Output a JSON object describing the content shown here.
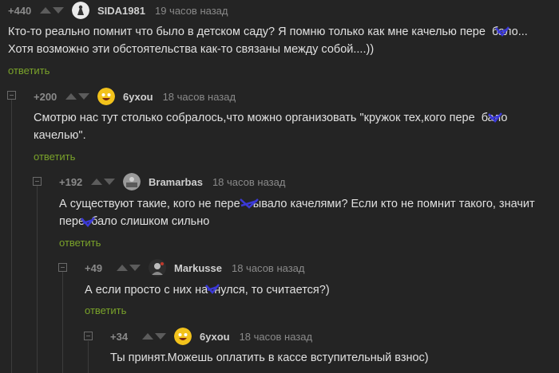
{
  "comments": [
    {
      "rating": "+440",
      "username": "SIDA1981",
      "time": "19 часов назад",
      "avatar_color": "#eaeaea",
      "text_line1": "Кто-то реально помнит что было в детском саду? Я помню только как мне качелью пере  бало...",
      "text_line2": "Хотя возможно эти обстоятельства как-то связаны между собой....))",
      "reply": "ответить"
    },
    {
      "rating": "+200",
      "username": "6yxou",
      "time": "18 часов назад",
      "avatar_color": "#f2c21b",
      "text_line1": "Смотрю нас тут столько собралось,что можно организовать \"кружок тех,кого пере  бало",
      "text_line2": "качелью\".",
      "reply": "ответить"
    },
    {
      "rating": "+192",
      "username": "Bramarbas",
      "time": "18 часов назад",
      "avatar_color": "#9a9a9a",
      "text_line1": "А существуют такие, кого не пере    ывало качелями? Если кто не помнит такого, значит",
      "text_line2": "пере  бало слишком сильно",
      "reply": "ответить"
    },
    {
      "rating": "+49",
      "username": "Markusse",
      "time": "18 часов назад",
      "avatar_color": "#7a7a7a",
      "text_line1": "А если просто с них на  нулся, то считается?)",
      "reply": "ответить"
    },
    {
      "rating": "+34",
      "username": "6yxou",
      "time": "18 часов назад",
      "avatar_color": "#f2c21b",
      "text_line1": "Ты принят.Можешь оплатить в кассе вступительный взнос)"
    }
  ],
  "colors": {
    "background": "#242424",
    "reply_link": "#7aa32a",
    "scribble": "#3b39d6"
  }
}
